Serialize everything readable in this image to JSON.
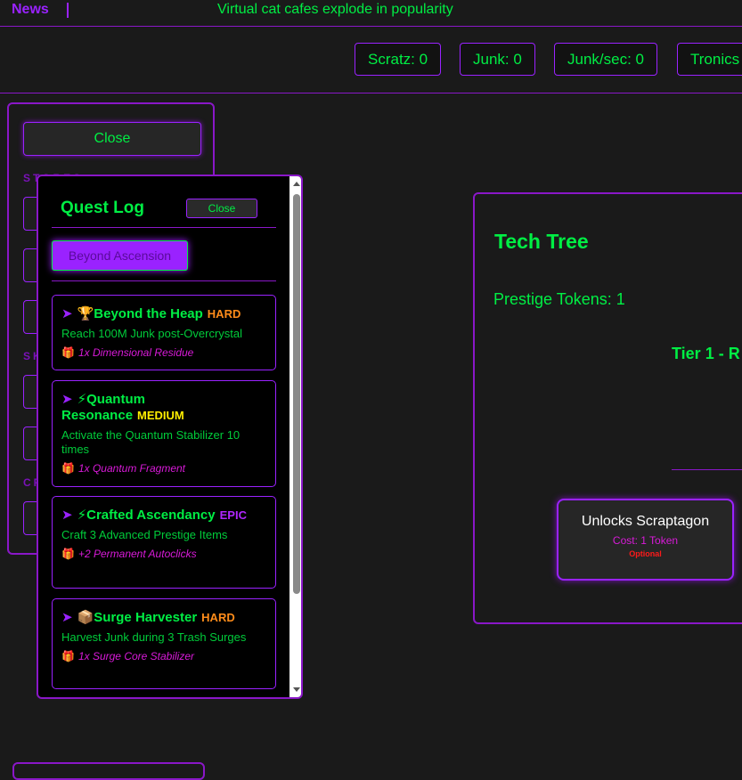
{
  "news": {
    "label": "News",
    "ticker": "Virtual cat cafes explode in popularity"
  },
  "stats": [
    {
      "label": "Scratz: 0"
    },
    {
      "label": "Junk: 0"
    },
    {
      "label": "Junk/sec: 0"
    },
    {
      "label": "Tronics"
    }
  ],
  "left_panel": {
    "close_label": "Close",
    "headings": [
      "STORES",
      "SK",
      "CR"
    ]
  },
  "tech_tree": {
    "title": "Tech Tree",
    "prestige_tokens": "Prestige Tokens: 1",
    "tier_label": "Tier 1 - R",
    "node": {
      "title": "Unlocks Scraptagon",
      "cost": "Cost: 1 Token",
      "optional": "Optional"
    }
  },
  "quest_log": {
    "title": "Quest Log",
    "close_label": "Close",
    "filter_label": "Beyond Ascension",
    "quests": [
      {
        "icon": "🏆",
        "title": "Beyond the Heap",
        "difficulty": "HARD",
        "difficulty_color": "#ff8c1a",
        "description": "Reach 100M Junk post-Overcrystal",
        "reward": "1x Dimensional Residue"
      },
      {
        "icon": "⚡",
        "title": "Quantum Resonance",
        "difficulty": "MEDIUM",
        "difficulty_color": "#ffee00",
        "description": "Activate the Quantum Stabilizer 10 times",
        "reward": "1x Quantum Fragment"
      },
      {
        "icon": "⚡",
        "title": "Crafted Ascendancy",
        "difficulty": "EPIC",
        "difficulty_color": "#b026ff",
        "description": "Craft 3 Advanced Prestige Items",
        "reward": "+2 Permanent Autoclicks"
      },
      {
        "icon": "📦",
        "title": "Surge Harvester",
        "difficulty": "HARD",
        "difficulty_color": "#ff8c1a",
        "description": "Harvest Junk during 3 Trash Surges",
        "reward": "1x Surge Core Stabilizer"
      }
    ]
  },
  "colors": {
    "accent": "#9a22ff",
    "text": "#00ee44",
    "background": "#1a1a1a"
  }
}
